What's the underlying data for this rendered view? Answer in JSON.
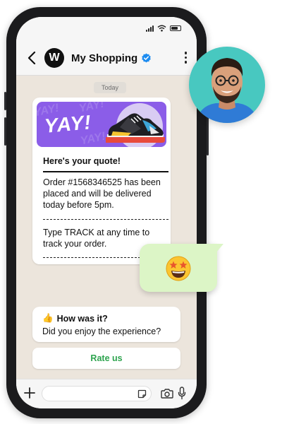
{
  "header": {
    "logo_letter": "W",
    "title": "My Shopping",
    "verified_icon": "verified-badge-icon",
    "back_icon": "chevron-left-icon",
    "menu_icon": "more-vertical-icon"
  },
  "date_label": "Today",
  "quote_card": {
    "banner_text": "YAY!",
    "title": "Here's your quote!",
    "order_text": "Order #1568346525 has been placed and will be delivered today before 5pm.",
    "track_text": "Type TRACK at any time to track your order."
  },
  "outgoing": {
    "emoji": "🤩"
  },
  "feedback": {
    "line1_emoji": "👍",
    "line1": "How was it?",
    "line2": "Did you enjoy the experience?",
    "button_label": "Rate us"
  },
  "composer": {
    "placeholder": "",
    "icons": [
      "plus-icon",
      "sticker-icon",
      "camera-icon",
      "mic-icon"
    ]
  },
  "colors": {
    "accent_green": "#2ea44f",
    "banner_purple": "#8b5de8",
    "chat_bg": "#ece5dc",
    "outgoing_bubble": "#dcf5c6",
    "avatar_bg": "#48c8c0",
    "verified_blue": "#1d8cf0"
  }
}
